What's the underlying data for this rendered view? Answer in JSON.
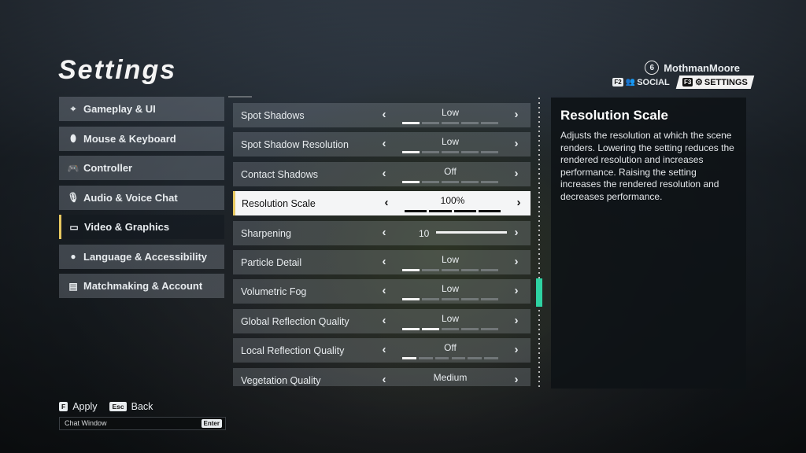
{
  "page_title": "Settings",
  "header": {
    "level": "6",
    "username": "MothmanMoore",
    "nav": [
      {
        "key": "F2",
        "label": "SOCIAL",
        "icon": "social-icon"
      },
      {
        "key": "F3",
        "label": "SETTINGS",
        "icon": "gear-icon"
      }
    ]
  },
  "sidebar": {
    "items": [
      {
        "label": "Gameplay & UI",
        "icon": "crosshair-icon",
        "glyph": "⌖"
      },
      {
        "label": "Mouse & Keyboard",
        "icon": "mouse-icon",
        "glyph": "⬮"
      },
      {
        "label": "Controller",
        "icon": "gamepad-icon",
        "glyph": "🎮"
      },
      {
        "label": "Audio & Voice Chat",
        "icon": "microphone-icon",
        "glyph": "🎙"
      },
      {
        "label": "Video & Graphics",
        "icon": "monitor-icon",
        "glyph": "▭"
      },
      {
        "label": "Language & Accessibility",
        "icon": "globe-icon",
        "glyph": "●"
      },
      {
        "label": "Matchmaking & Account",
        "icon": "list-icon",
        "glyph": "▤"
      }
    ],
    "active_index": 4
  },
  "settings": [
    {
      "label": "Spot Shadows",
      "value": "Low",
      "level": 1,
      "steps": 5
    },
    {
      "label": "Spot Shadow Resolution",
      "value": "Low",
      "level": 1,
      "steps": 5
    },
    {
      "label": "Contact Shadows",
      "value": "Off",
      "level": 1,
      "steps": 5
    },
    {
      "label": "Resolution Scale",
      "value": "100%",
      "level": 4,
      "steps": 4,
      "selected": true
    },
    {
      "label": "Sharpening",
      "value": "10",
      "slider": 1.0
    },
    {
      "label": "Particle Detail",
      "value": "Low",
      "level": 1,
      "steps": 5
    },
    {
      "label": "Volumetric Fog",
      "value": "Low",
      "level": 1,
      "steps": 5
    },
    {
      "label": "Global Reflection Quality",
      "value": "Low",
      "level": 2,
      "steps": 5
    },
    {
      "label": "Local Reflection Quality",
      "value": "Off",
      "level": 1,
      "steps": 6
    },
    {
      "label": "Vegetation Quality",
      "value": "Medium",
      "level": 3,
      "steps": 5
    }
  ],
  "description": {
    "title": "Resolution Scale",
    "text": "Adjusts the resolution at which the scene renders. Lowering the setting reduces the rendered resolution and increases performance. Raising the setting increases the rendered resolution and decreases performance."
  },
  "footer": {
    "apply_key": "F",
    "apply_label": "Apply",
    "back_key": "Esc",
    "back_label": "Back",
    "chat_placeholder": "Chat Window",
    "chat_enter_key": "Enter"
  },
  "colors": {
    "accent": "#e7c860",
    "scroll_thumb": "#2ed3a2"
  }
}
